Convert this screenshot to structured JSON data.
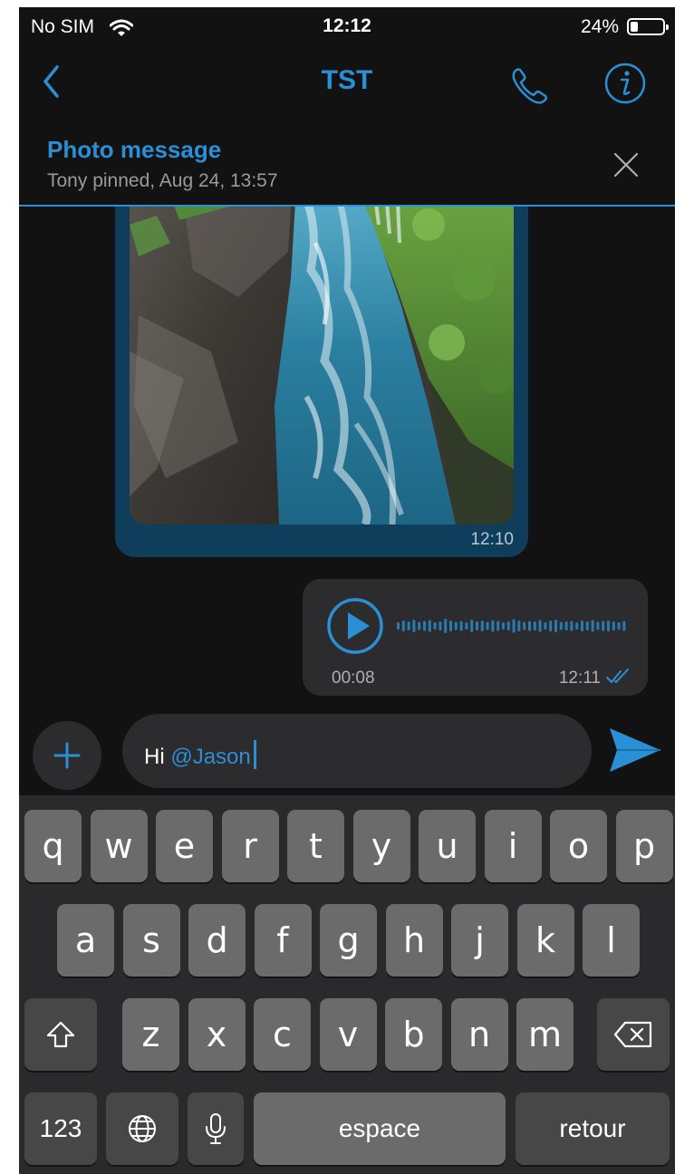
{
  "status_bar": {
    "carrier": "No SIM",
    "time": "12:12",
    "battery_percent": "24%",
    "battery_level": 0.24
  },
  "nav": {
    "title": "TST",
    "icons": [
      "back-chevron-icon",
      "phone-icon",
      "info-icon"
    ]
  },
  "pinned": {
    "title": "Photo message",
    "subtitle": "Tony pinned, Aug 24, 13:57",
    "icon": "close-icon"
  },
  "messages": {
    "photo": {
      "time": "12:10"
    },
    "voice": {
      "duration": "00:08",
      "time": "12:11",
      "status": "read"
    }
  },
  "composer": {
    "text_prefix": "Hi ",
    "mention": "@Jason",
    "icons": [
      "plus-icon",
      "send-icon"
    ]
  },
  "keyboard": {
    "row1": [
      "q",
      "w",
      "e",
      "r",
      "t",
      "y",
      "u",
      "i",
      "o",
      "p"
    ],
    "row2": [
      "a",
      "s",
      "d",
      "f",
      "g",
      "h",
      "j",
      "k",
      "l"
    ],
    "row3": [
      "z",
      "x",
      "c",
      "v",
      "b",
      "n",
      "m"
    ],
    "numbers_label": "123",
    "space_label": "espace",
    "return_label": "retour"
  },
  "colors": {
    "accent": "#2b8fd6",
    "background": "#121212",
    "bubble_incoming": "#0f3d5c",
    "bubble_outgoing": "#2c2c2e",
    "key": "#6b6b6b",
    "key_dark": "#474747"
  }
}
